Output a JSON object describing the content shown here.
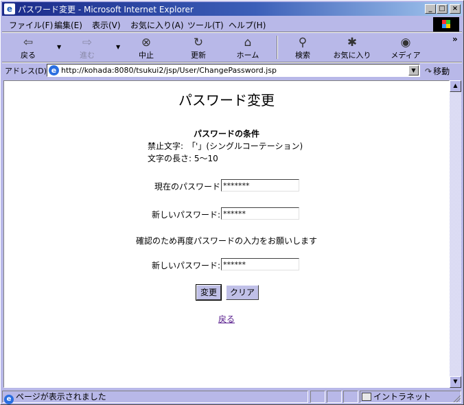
{
  "window": {
    "title": "パスワード変更 - Microsoft Internet Explorer",
    "icon": "ie-icon",
    "min_label": "_",
    "max_label": "□",
    "close_label": "×"
  },
  "menu": [
    "ファイル(F)",
    "編集(E)",
    "表示(V)",
    "お気に入り(A)",
    "ツール(T)",
    "ヘルプ(H)"
  ],
  "toolbar": {
    "back": "戻る",
    "forward": "進む",
    "stop": "中止",
    "refresh": "更新",
    "home": "ホーム",
    "search": "検索",
    "favorites": "お気に入り",
    "media": "メディア",
    "more": "»",
    "drop": "▼"
  },
  "address": {
    "label": "アドレス(D)",
    "url": "http://kohada:8080/tsukui2/jsp/User/ChangePassword.jsp",
    "go_label": "移動"
  },
  "page": {
    "title": "パスワード変更",
    "conditions_title": "パスワードの条件",
    "forbidden": "禁止文字:　「'」(シングルコーテーション)",
    "length": "文字の長さ: 5～10",
    "current_label": "現在のパスワード",
    "current_value": "*******",
    "new_label": "新しいパスワード:",
    "new_value": "******",
    "confirm_note": "確認のため再度パスワードの入力をお願いします",
    "confirm_label": "新しいパスワード:",
    "confirm_value": "******",
    "submit": "変更",
    "clear": "クリア",
    "back_link": "戻る"
  },
  "status": {
    "text": "ページが表示されました",
    "zone": "イントラネット"
  }
}
